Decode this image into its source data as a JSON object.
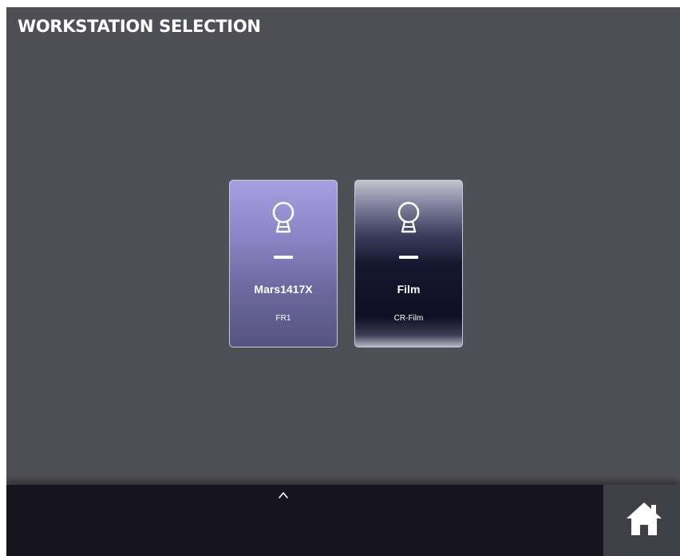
{
  "header": {
    "title": "WORKSTATION SELECTION"
  },
  "workstations": [
    {
      "name": "Mars1417X",
      "subtitle": "FR1",
      "selected": true,
      "icon": "detector-icon"
    },
    {
      "name": "Film",
      "subtitle": "CR-Film",
      "selected": false,
      "icon": "detector-icon"
    }
  ],
  "bottom_bar": {
    "expand_icon": "chevron-up-icon",
    "home_icon": "home-icon"
  },
  "colors": {
    "background": "#4f5055",
    "bottom_bar": "#15141f",
    "home_button": "#3f4046",
    "selected_card_top": "#a7a0e0",
    "selected_card_bottom": "#555380",
    "unselected_card": "#0e0f22"
  }
}
